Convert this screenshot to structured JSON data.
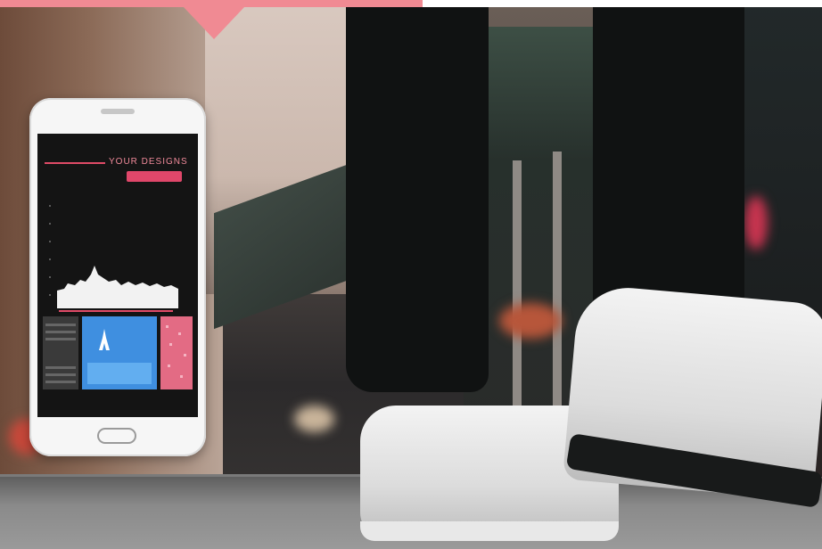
{
  "phone_screen": {
    "title": "YOUR DESIGNS",
    "pill_label": "",
    "left_tile_text": "",
    "middle_tile_text": ""
  }
}
